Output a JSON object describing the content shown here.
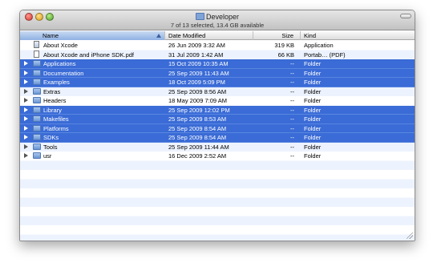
{
  "window": {
    "title": "Developer",
    "status": "7 of 13 selected, 13.4 GB available"
  },
  "columns": {
    "name": "Name",
    "date": "Date Modified",
    "size": "Size",
    "kind": "Kind"
  },
  "rows": [
    {
      "name": "About Xcode",
      "date": "26 Jun 2009 3:32 AM",
      "size": "319 KB",
      "kind": "Application",
      "icon": "app-icon",
      "expandable": false,
      "selected": false
    },
    {
      "name": "About Xcode and iPhone SDK.pdf",
      "date": "31 Jul 2009 1:42 AM",
      "size": "66 KB",
      "kind": "Portab… (PDF)",
      "icon": "pdf-icon",
      "expandable": false,
      "selected": false
    },
    {
      "name": "Applications",
      "date": "15 Oct 2009 10:35 AM",
      "size": "--",
      "kind": "Folder",
      "icon": "folder-icon",
      "expandable": true,
      "selected": true
    },
    {
      "name": "Documentation",
      "date": "25 Sep 2009 11:43 AM",
      "size": "--",
      "kind": "Folder",
      "icon": "folder-icon",
      "expandable": true,
      "selected": true
    },
    {
      "name": "Examples",
      "date": "18 Oct 2009 5:09 PM",
      "size": "--",
      "kind": "Folder",
      "icon": "folder-icon",
      "expandable": true,
      "selected": true
    },
    {
      "name": "Extras",
      "date": "25 Sep 2009 8:56 AM",
      "size": "--",
      "kind": "Folder",
      "icon": "folder-icon",
      "expandable": true,
      "selected": false
    },
    {
      "name": "Headers",
      "date": "18 May 2009 7:09 AM",
      "size": "--",
      "kind": "Folder",
      "icon": "folder-icon",
      "expandable": true,
      "selected": false
    },
    {
      "name": "Library",
      "date": "25 Sep 2009 12:02 PM",
      "size": "--",
      "kind": "Folder",
      "icon": "folder-icon",
      "expandable": true,
      "selected": true
    },
    {
      "name": "Makefiles",
      "date": "25 Sep 2009 8:53 AM",
      "size": "--",
      "kind": "Folder",
      "icon": "folder-icon",
      "expandable": true,
      "selected": true
    },
    {
      "name": "Platforms",
      "date": "25 Sep 2009 8:54 AM",
      "size": "--",
      "kind": "Folder",
      "icon": "folder-icon",
      "expandable": true,
      "selected": true
    },
    {
      "name": "SDKs",
      "date": "25 Sep 2009 8:54 AM",
      "size": "--",
      "kind": "Folder",
      "icon": "folder-icon",
      "expandable": true,
      "selected": true
    },
    {
      "name": "Tools",
      "date": "25 Sep 2009 11:44 AM",
      "size": "--",
      "kind": "Folder",
      "icon": "folder-icon",
      "expandable": true,
      "selected": false
    },
    {
      "name": "usr",
      "date": "16 Dec 2009 2:52 AM",
      "size": "--",
      "kind": "Folder",
      "icon": "folder-icon",
      "expandable": true,
      "selected": false
    }
  ],
  "colors": {
    "selection": "#3a6bd6",
    "alternate_row": "#edf3fe",
    "sorted_header": "#8fb1e3"
  }
}
